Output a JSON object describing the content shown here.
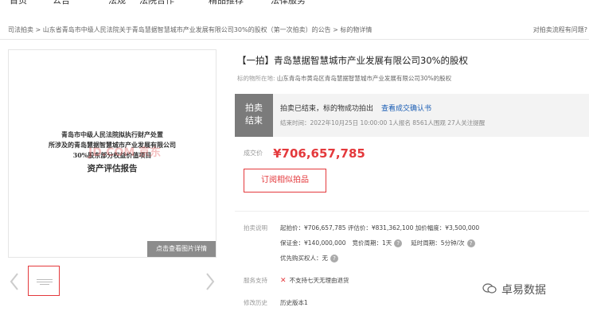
{
  "topnav": [
    "首页",
    "公告",
    "法规",
    "法院合作",
    "精品推荐",
    "法律服务"
  ],
  "breadcrumb": {
    "text": "司法拍卖 > 山东省青岛市中级人民法院关于青岛慧据智慧城市产业发展有限公司30%的股权（第一次拍卖）的公告 > 标的物详情",
    "help": "对拍卖流程有问题?"
  },
  "image": {
    "doc_lines": [
      "青岛市中级人民法院拟执行财产处置",
      "所涉及的青岛慧据智慧城市产业发展有限公司",
      "30%股东部分权益价值项目",
      "资产评估报告"
    ],
    "watermark": "JD.COM 京东",
    "detail_button": "点击查看图片详情"
  },
  "item": {
    "title": "【一拍】青岛慧据智慧城市产业发展有限公司30%的股权",
    "location_label": "标的物所在地:",
    "location": "山东青岛市黄岛区青岛慧据智慧城市产业发展有限公司30%的股权"
  },
  "status": {
    "tag_line1": "拍卖",
    "tag_line2": "结束",
    "message": "拍卖已结束，标的物成功拍出",
    "link": "查看成交确认书",
    "detail": "结束时间：2022年10月25日 10:00:00  1人报名  8561人围观  27人关注提醒"
  },
  "price": {
    "label": "成交价",
    "value": "¥706,657,785"
  },
  "subscribe_button": "订阅相似拍品",
  "auction_info": {
    "label": "拍卖说明",
    "line1": "起拍价：¥706,657,785   评估价：¥831,362,100   加价幅度：¥3,500,000",
    "deposit": "保证金：¥140,000,000",
    "bid_cycle": "竞价周期：1天",
    "delay_cycle": "延时周期：5分钟/次",
    "priority": "优先购买权人：无"
  },
  "service": {
    "label": "服务支持",
    "text": "不支持七天无理由退货"
  },
  "history": {
    "label": "修改历史",
    "text": "历史版本1"
  },
  "brand": "卓易数据",
  "colors": {
    "accent": "#e4393c",
    "link": "#1a5db4",
    "status_tag": "#7b7b7b"
  }
}
